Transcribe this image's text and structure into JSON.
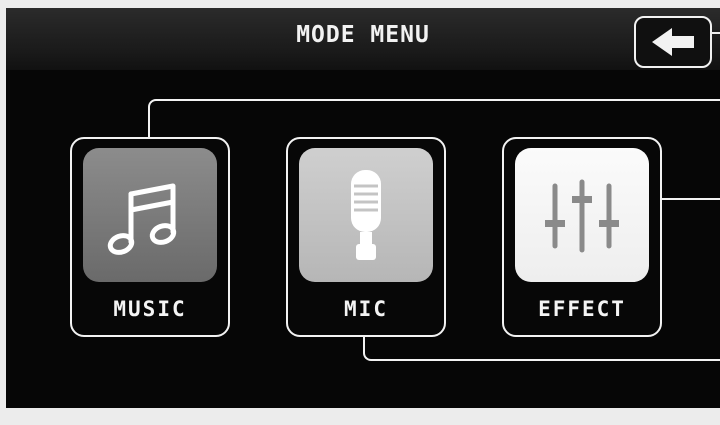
{
  "header": {
    "title": "MODE MENU",
    "back_icon": "back-arrow-icon"
  },
  "modes": [
    {
      "label": "MUSIC",
      "icon": "music-note-icon"
    },
    {
      "label": "MIC",
      "icon": "microphone-icon"
    },
    {
      "label": "EFFECT",
      "icon": "equalizer-sliders-icon"
    }
  ],
  "colors": {
    "screen_background": "#060606",
    "outline": "#f2f2f2",
    "music_tile": "#7a7a7a",
    "mic_tile": "#c4c4c4",
    "effect_tile": "#f5f5f5"
  }
}
